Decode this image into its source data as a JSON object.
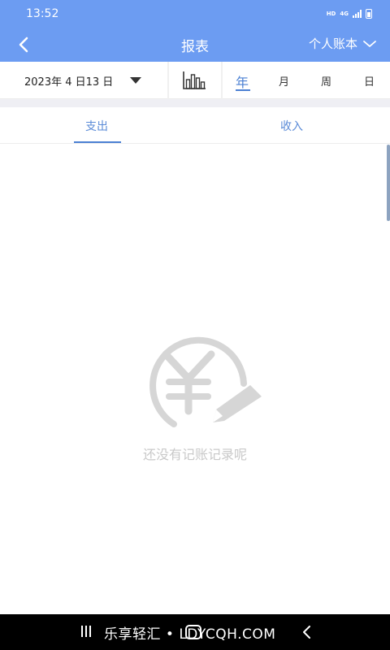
{
  "status_bar": {
    "time": "13:52",
    "hd": "HD",
    "network": "4G"
  },
  "header": {
    "title": "报表",
    "book": "个人账本",
    "back_icon": "chevron-left-icon",
    "book_dropdown_icon": "chevron-down-icon"
  },
  "filters": {
    "date": "2023年 4 日13 日",
    "chart_icon": "bar-chart-icon",
    "periods": [
      "年",
      "月",
      "周",
      "日"
    ],
    "active_period": "年"
  },
  "type_tabs": {
    "expense": "支出",
    "income": "收入",
    "active": "支出"
  },
  "empty_state": {
    "icon": "yen-edit-icon",
    "message": "还没有记账记录呢"
  },
  "watermark": "乐享轻汇 • LDYCQH.COM",
  "colors": {
    "primary": "#6c9cf2",
    "accent": "#4b80d3",
    "divider": "#efeff4",
    "empty": "#d6d6d6"
  }
}
